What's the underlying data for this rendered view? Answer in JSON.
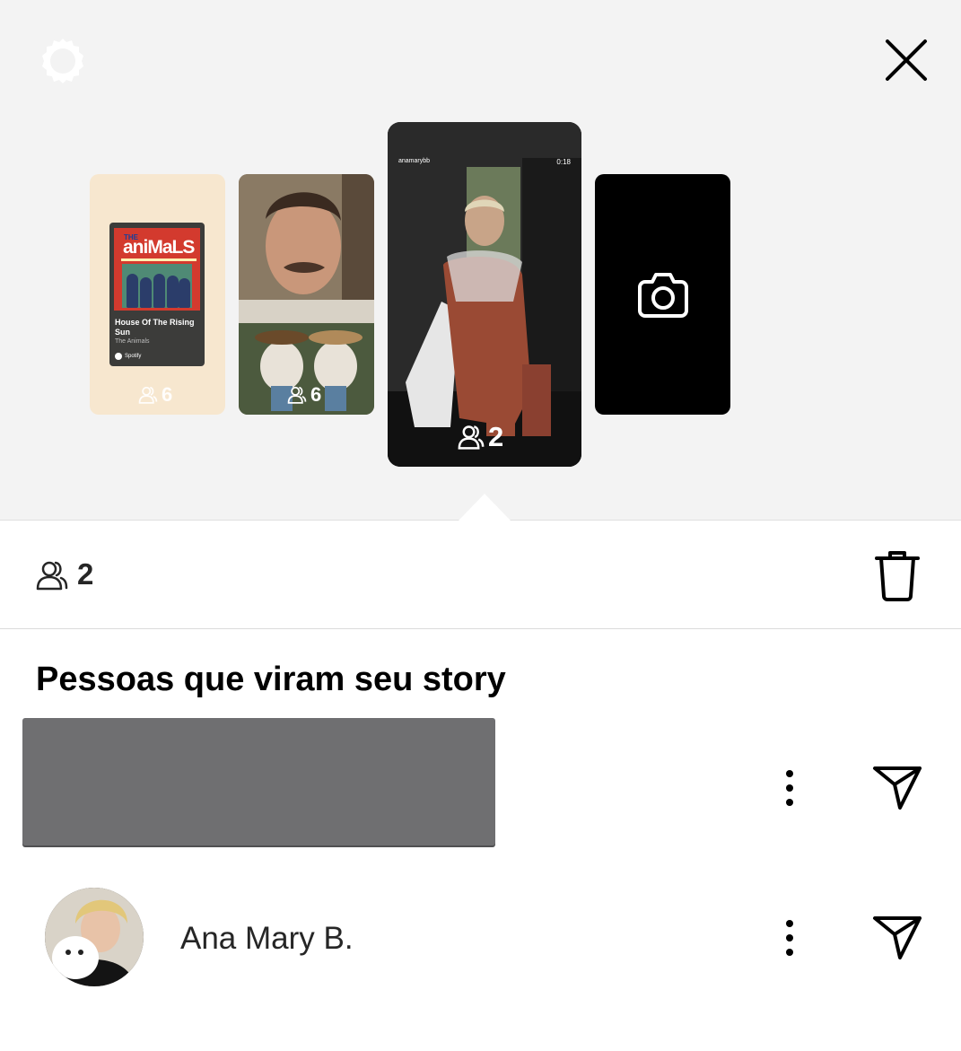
{
  "header": {
    "settings_icon": "gear-icon",
    "close_icon": "close-icon"
  },
  "stories": [
    {
      "kind": "music",
      "album": {
        "logo_top": "THE",
        "logo": "aniMaLS",
        "song_title": "House Of The Rising Sun",
        "artist": "The Animals",
        "service": "Spotify"
      },
      "viewers": "6"
    },
    {
      "kind": "photo",
      "viewers": "6"
    },
    {
      "kind": "video",
      "selected": true,
      "username": "anamarybb",
      "duration": "0:18",
      "viewers": "2"
    },
    {
      "kind": "camera",
      "icon": "camera-icon"
    }
  ],
  "stats": {
    "viewer_icon": "viewers-icon",
    "viewer_count": "2",
    "delete_icon": "trash-icon"
  },
  "section": {
    "title": "Pessoas que viram seu story"
  },
  "viewers": [
    {
      "name": "",
      "redacted": true,
      "more_icon": "more-options-icon",
      "send_icon": "send-icon"
    },
    {
      "name": "Ana Mary B.",
      "more_icon": "more-options-icon",
      "send_icon": "send-icon"
    }
  ],
  "colors": {
    "top_background": "#f3f3f3",
    "text_primary": "#262626",
    "redaction": "#6f6f71"
  }
}
